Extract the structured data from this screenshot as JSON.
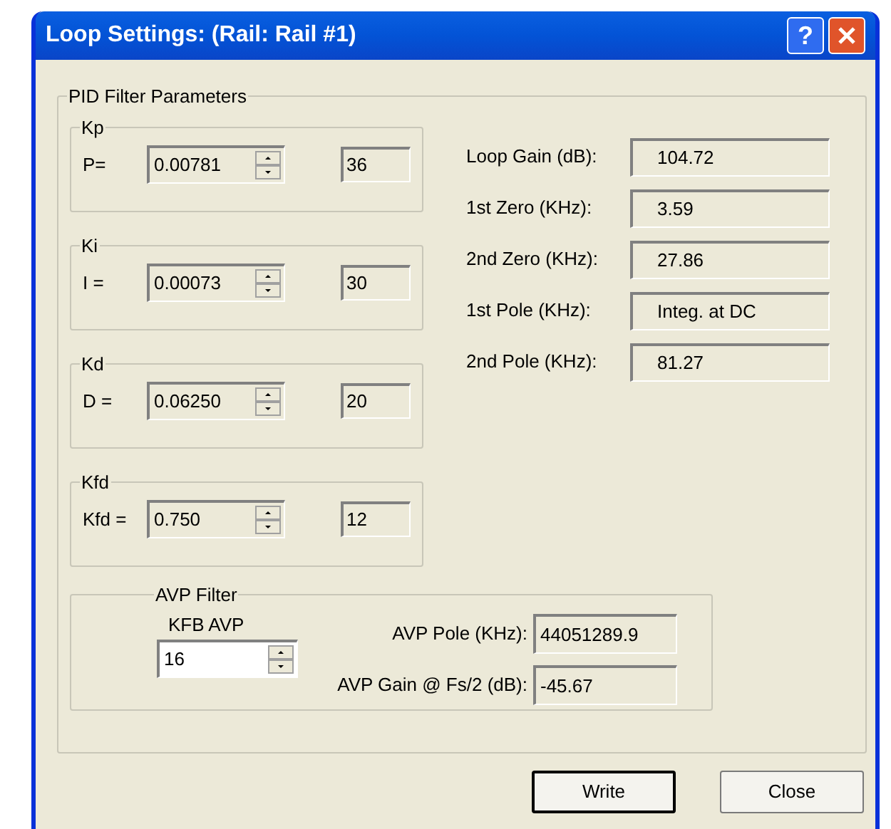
{
  "window": {
    "title": "Loop Settings: (Rail: Rail #1)",
    "help_button": "?"
  },
  "pid_group": {
    "title": "PID Filter Parameters",
    "gains": [
      {
        "title": "Kp",
        "label": "P=",
        "value": "0.00781",
        "disabled": true,
        "code": "36"
      },
      {
        "title": "Ki",
        "label": "I =",
        "value": "0.00073",
        "disabled": true,
        "code": "30"
      },
      {
        "title": "Kd",
        "label": "D =",
        "value": "0.06250",
        "disabled": true,
        "code": "20"
      },
      {
        "title": "Kfd",
        "label": "Kfd =",
        "value": "0.750",
        "disabled": true,
        "code": "12"
      }
    ],
    "results": [
      {
        "label": "Loop Gain (dB):",
        "value": "104.72"
      },
      {
        "label": "1st Zero (KHz):",
        "value": "3.59"
      },
      {
        "label": "2nd Zero (KHz):",
        "value": "27.86"
      },
      {
        "label": "1st Pole (KHz):",
        "value": "Integ. at DC"
      },
      {
        "label": "2nd Pole (KHz):",
        "value": "81.27"
      }
    ]
  },
  "avp_group": {
    "title": "AVP Filter",
    "kfb": {
      "label": "KFB AVP",
      "value": "16",
      "disabled": false
    },
    "results": [
      {
        "label": "AVP Pole (KHz):",
        "value": "44051289.9"
      },
      {
        "label": "AVP Gain @ Fs/2 (dB):",
        "value": "-45.67"
      }
    ]
  },
  "buttons": [
    {
      "label": "Write",
      "default": true
    },
    {
      "label": "Close",
      "default": false
    }
  ]
}
